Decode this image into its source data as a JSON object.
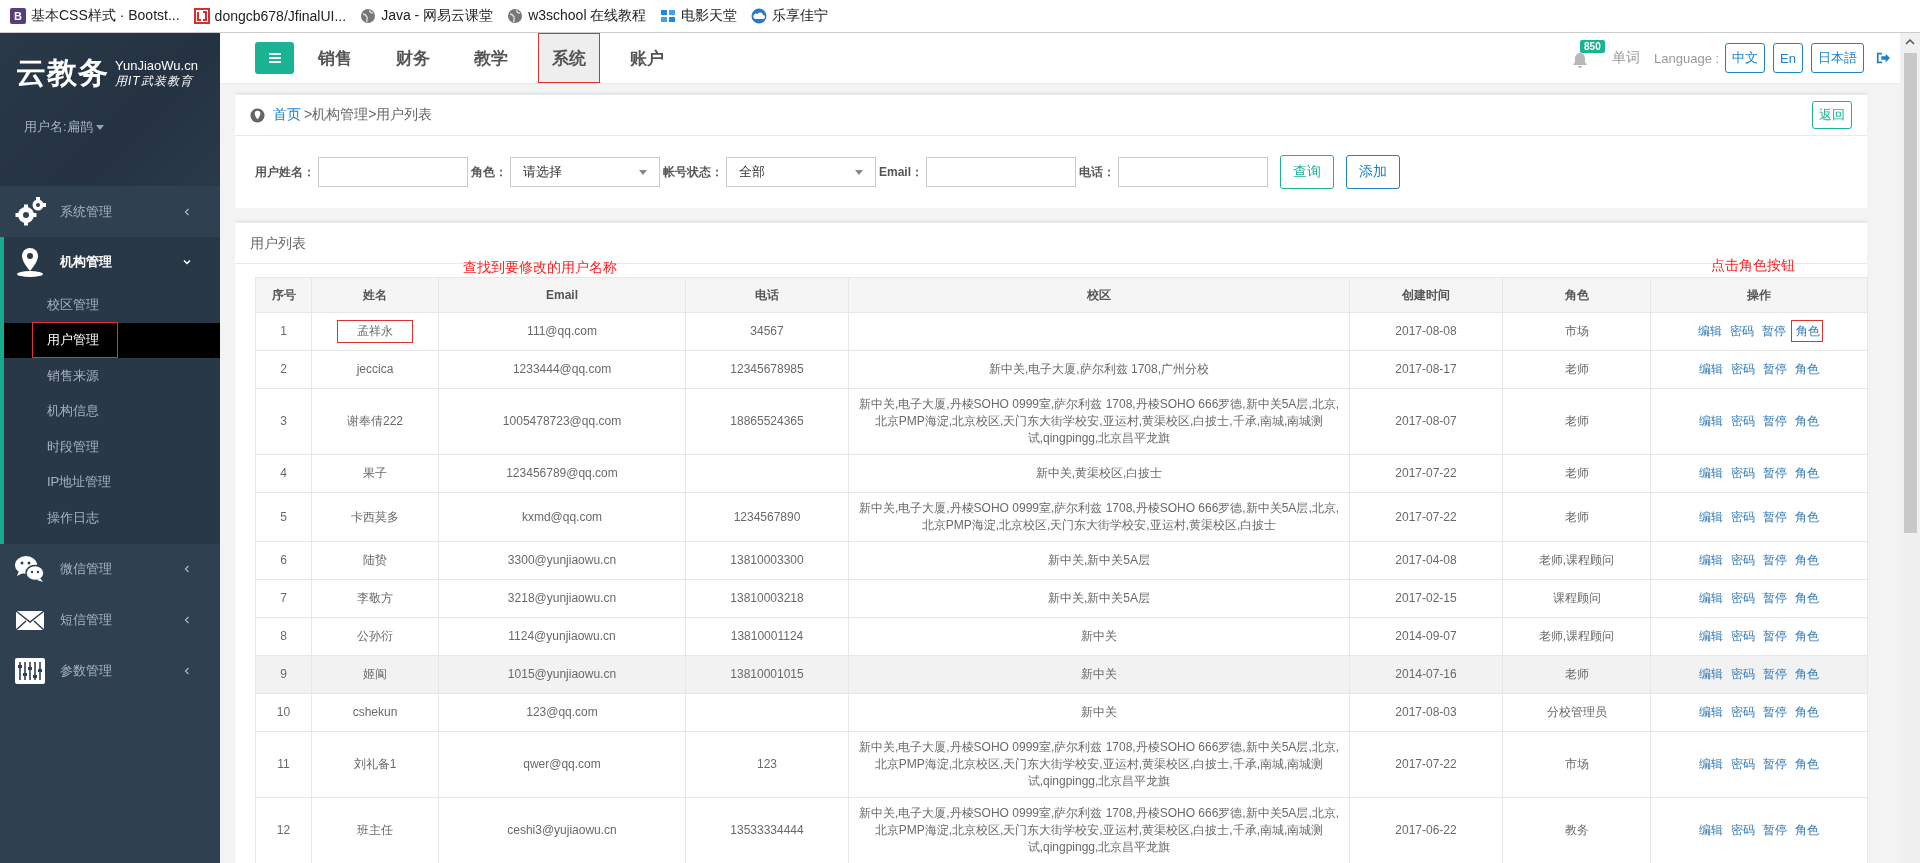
{
  "bookmarks": [
    {
      "label": "基本CSS样式 · Bootst...",
      "kind": "letter",
      "badge": "B"
    },
    {
      "label": "dongcb678/JfinalUI...",
      "kind": "red"
    },
    {
      "label": "Java - 网易云课堂",
      "kind": "globe"
    },
    {
      "label": "w3school 在线教程",
      "kind": "globe"
    },
    {
      "label": "电影天堂",
      "kind": "tile"
    },
    {
      "label": "乐享佳宁",
      "kind": "cloud"
    }
  ],
  "sidebar": {
    "brand": "云教务",
    "brand_sub": "YunJiaoWu.cn",
    "slogan": "用IT武装教育",
    "user": "用户名:扁鹊",
    "menu": [
      {
        "label": "系统管理",
        "kind": "gears",
        "expanded": false
      },
      {
        "label": "机构管理",
        "kind": "pin",
        "expanded": true,
        "children": [
          {
            "label": "校区管理",
            "selected": false,
            "marked": false
          },
          {
            "label": "用户管理",
            "selected": true,
            "marked": true
          },
          {
            "label": "销售来源",
            "selected": false,
            "marked": false
          },
          {
            "label": "机构信息",
            "selected": false,
            "marked": false
          },
          {
            "label": "时段管理",
            "selected": false,
            "marked": false
          },
          {
            "label": "IP地址管理",
            "selected": false,
            "marked": false
          },
          {
            "label": "操作日志",
            "selected": false,
            "marked": false
          }
        ]
      },
      {
        "label": "微信管理",
        "kind": "chat",
        "expanded": false
      },
      {
        "label": "短信管理",
        "kind": "mail",
        "expanded": false
      },
      {
        "label": "参数管理",
        "kind": "sliders",
        "expanded": false
      }
    ]
  },
  "topnav": {
    "tabs": [
      {
        "label": "销售",
        "selected": false,
        "marked": false
      },
      {
        "label": "财务",
        "selected": false,
        "marked": false
      },
      {
        "label": "教学",
        "selected": false,
        "marked": false
      },
      {
        "label": "系统",
        "selected": true,
        "marked": true
      },
      {
        "label": "账户",
        "selected": false,
        "marked": false
      }
    ],
    "badge": "850",
    "words": "单词",
    "language_label": "Language :",
    "languages": [
      "中文",
      "En",
      "日本語"
    ]
  },
  "breadcrumb": [
    {
      "label": "首页",
      "link": true
    },
    {
      "label": ">机构管理",
      "link": false
    },
    {
      "label": ">用户列表",
      "link": false
    }
  ],
  "back_button": "返回",
  "filters": [
    {
      "label": "用户姓名：",
      "kind": "text"
    },
    {
      "label": "角色：",
      "kind": "select",
      "value": "请选择"
    },
    {
      "label": "帐号状态：",
      "kind": "select",
      "value": "全部"
    },
    {
      "label": "Email：",
      "kind": "text"
    },
    {
      "label": "电话：",
      "kind": "text"
    }
  ],
  "filter_buttons": [
    {
      "label": "查询",
      "color": "#1ab394"
    },
    {
      "label": "添加",
      "color": "#1c84c6"
    }
  ],
  "table": {
    "title": "用户列表",
    "annotations": [
      {
        "text": "查找到要修改的用户名称",
        "kind": "left"
      },
      {
        "text": "点击角色按钮",
        "kind": "right"
      }
    ],
    "columns": [
      "序号",
      "姓名",
      "Email",
      "电话",
      "校区",
      "创建时间",
      "角色",
      "操作"
    ],
    "rows": [
      {
        "no": "1",
        "name": "孟祥永",
        "name_marked": true,
        "email": "111@qq.com",
        "phone": "34567",
        "created": "2017-08-08",
        "role": "市场",
        "highlighted": false,
        "actions": [
          {
            "label": "编辑",
            "marked": false
          },
          {
            "label": "密码",
            "marked": false
          },
          {
            "label": "暂停",
            "marked": false
          },
          {
            "label": "角色",
            "marked": true
          }
        ]
      },
      {
        "no": "2",
        "name": "jeccica",
        "name_marked": false,
        "email": "1233444@qq.com",
        "phone": "12345678985",
        "campus": "新中关,电子大厦,萨尔利兹 1708,广州分校",
        "created": "2017-08-17",
        "role": "老师",
        "highlighted": false,
        "actions": [
          {
            "label": "编辑",
            "marked": false
          },
          {
            "label": "密码",
            "marked": false
          },
          {
            "label": "暂停",
            "marked": false
          },
          {
            "label": "角色",
            "marked": false
          }
        ]
      },
      {
        "no": "3",
        "name": "谢奉倩222",
        "name_marked": false,
        "email": "1005478723@qq.com",
        "phone": "18865524365",
        "campus": "新中关,电子大厦,丹棱SOHO 0999室,萨尔利兹 1708,丹棱SOHO 666罗德,新中关5A层,北京,北京PMP海淀,北京校区,天门东大街学校安,亚运村,黄渠校区,白披士,千承,南城,南城测试,qingpingg,北京昌平龙旗",
        "created": "2017-08-07",
        "role": "老师",
        "highlighted": false,
        "actions": [
          {
            "label": "编辑",
            "marked": false
          },
          {
            "label": "密码",
            "marked": false
          },
          {
            "label": "暂停",
            "marked": false
          },
          {
            "label": "角色",
            "marked": false
          }
        ]
      },
      {
        "no": "4",
        "name": "果子",
        "name_marked": false,
        "email": "123456789@qq.com",
        "campus": "新中关,黄渠校区,白披士",
        "created": "2017-07-22",
        "role": "老师",
        "highlighted": false,
        "actions": [
          {
            "label": "编辑",
            "marked": false
          },
          {
            "label": "密码",
            "marked": false
          },
          {
            "label": "暂停",
            "marked": false
          },
          {
            "label": "角色",
            "marked": false
          }
        ]
      },
      {
        "no": "5",
        "name": "卡西莫多",
        "name_marked": false,
        "email": "kxmd@qq.com",
        "phone": "1234567890",
        "campus": "新中关,电子大厦,丹棱SOHO 0999室,萨尔利兹 1708,丹棱SOHO 666罗德,新中关5A层,北京,北京PMP海淀,北京校区,天门东大街学校安,亚运村,黄渠校区,白披士",
        "created": "2017-07-22",
        "role": "老师",
        "highlighted": false,
        "actions": [
          {
            "label": "编辑",
            "marked": false
          },
          {
            "label": "密码",
            "marked": false
          },
          {
            "label": "暂停",
            "marked": false
          },
          {
            "label": "角色",
            "marked": false
          }
        ]
      },
      {
        "no": "6",
        "name": "陆贽",
        "name_marked": false,
        "email": "3300@yunjiaowu.cn",
        "phone": "13810003300",
        "campus": "新中关,新中关5A层",
        "created": "2017-04-08",
        "role": "老师,课程顾问",
        "highlighted": false,
        "actions": [
          {
            "label": "编辑",
            "marked": false
          },
          {
            "label": "密码",
            "marked": false
          },
          {
            "label": "暂停",
            "marked": false
          },
          {
            "label": "角色",
            "marked": false
          }
        ]
      },
      {
        "no": "7",
        "name": "李敬方",
        "name_marked": false,
        "email": "3218@yunjiaowu.cn",
        "phone": "13810003218",
        "campus": "新中关,新中关5A层",
        "created": "2017-02-15",
        "role": "课程顾问",
        "highlighted": false,
        "actions": [
          {
            "label": "编辑",
            "marked": false
          },
          {
            "label": "密码",
            "marked": false
          },
          {
            "label": "暂停",
            "marked": false
          },
          {
            "label": "角色",
            "marked": false
          }
        ]
      },
      {
        "no": "8",
        "name": "公孙衍",
        "name_marked": false,
        "email": "1124@yunjiaowu.cn",
        "phone": "13810001124",
        "campus": "新中关",
        "created": "2014-09-07",
        "role": "老师,课程顾问",
        "highlighted": false,
        "actions": [
          {
            "label": "编辑",
            "marked": false
          },
          {
            "label": "密码",
            "marked": false
          },
          {
            "label": "暂停",
            "marked": false
          },
          {
            "label": "角色",
            "marked": false
          }
        ]
      },
      {
        "no": "9",
        "name": "姬阆",
        "name_marked": false,
        "email": "1015@yunjiaowu.cn",
        "phone": "13810001015",
        "campus": "新中关",
        "created": "2014-07-16",
        "role": "老师",
        "highlighted": true,
        "actions": [
          {
            "label": "编辑",
            "marked": false
          },
          {
            "label": "密码",
            "marked": false
          },
          {
            "label": "暂停",
            "marked": false
          },
          {
            "label": "角色",
            "marked": false
          }
        ]
      },
      {
        "no": "10",
        "name": "cshekun",
        "name_marked": false,
        "email": "123@qq.com",
        "campus": "新中关",
        "created": "2017-08-03",
        "role": "分校管理员",
        "highlighted": false,
        "actions": [
          {
            "label": "编辑",
            "marked": false
          },
          {
            "label": "密码",
            "marked": false
          },
          {
            "label": "暂停",
            "marked": false
          },
          {
            "label": "角色",
            "marked": false
          }
        ]
      },
      {
        "no": "11",
        "name": "刘礼备1",
        "name_marked": false,
        "email": "qwer@qq.com",
        "phone": "123",
        "campus": "新中关,电子大厦,丹棱SOHO 0999室,萨尔利兹 1708,丹棱SOHO 666罗德,新中关5A层,北京,北京PMP海淀,北京校区,天门东大街学校安,亚运村,黄渠校区,白披士,千承,南城,南城测试,qingpingg,北京昌平龙旗",
        "created": "2017-07-22",
        "role": "市场",
        "highlighted": false,
        "actions": [
          {
            "label": "编辑",
            "marked": false
          },
          {
            "label": "密码",
            "marked": false
          },
          {
            "label": "暂停",
            "marked": false
          },
          {
            "label": "角色",
            "marked": false
          }
        ]
      },
      {
        "no": "12",
        "name": "班主任",
        "name_marked": false,
        "email": "ceshi3@yujiaowu.cn",
        "phone": "13533334444",
        "campus": "新中关,电子大厦,丹棱SOHO 0999室,萨尔利兹 1708,丹棱SOHO 666罗德,新中关5A层,北京,北京PMP海淀,北京校区,天门东大街学校安,亚运村,黄渠校区,白披士,千承,南城,南城测试,qingpingg,北京昌平龙旗",
        "created": "2017-06-22",
        "role": "教务",
        "highlighted": false,
        "actions": [
          {
            "label": "编辑",
            "marked": false
          },
          {
            "label": "密码",
            "marked": false
          },
          {
            "label": "暂停",
            "marked": false
          },
          {
            "label": "角色",
            "marked": false
          }
        ]
      }
    ]
  }
}
